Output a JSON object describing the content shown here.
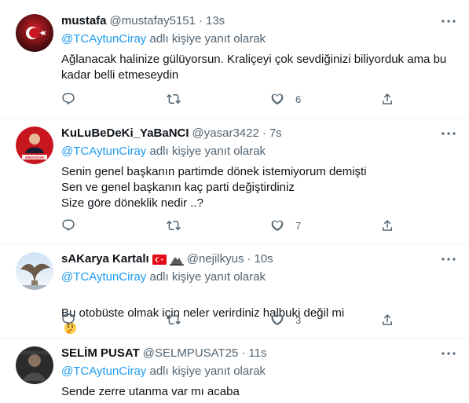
{
  "tweets": [
    {
      "name": "mustafa",
      "handle": "@mustafay5151",
      "time": "13s",
      "reply_prefix": "@TCAytunCiray",
      "reply_suffix": " adlı kişiye yanıt olarak",
      "text": "Ağlanacak halinize gülüyorsun. Kraliçeyi çok sevdiğinizi biliyorduk ama bu\nkadar belli etmeseydin",
      "reply_count": "",
      "retweet_count": "",
      "like_count": "6",
      "avatar": "turkish-flag-avatar"
    },
    {
      "name": "KuLuBeDeKi_YaBaNCI",
      "handle": "@yasar3422",
      "time": "7s",
      "reply_prefix": "@TCAytunCiray",
      "reply_suffix": " adlı kişiye yanıt olarak",
      "text": "Senin genel başkanın partimde dönek istemiyorum demişti\nSen ve genel başkanın kaç parti değiştirdiniz\nSize göre döneklik nedir ..?",
      "reply_count": "",
      "retweet_count": "",
      "like_count": "7",
      "avatar": "red-portrait-avatar",
      "avatar_caption": "ERDOĞAN"
    },
    {
      "name": "sAKarya Kartalı",
      "handle": "@nejilkyus",
      "time": "10s",
      "reply_prefix": "@TCAytunCiray",
      "reply_suffix": " adlı kişiye yanıt olarak",
      "text": "Bu otobüste olmak için neler verirdiniz halbuki değil mi",
      "reply_count": "",
      "retweet_count": "",
      "like_count": "3",
      "avatar": "eagle-statue-avatar"
    },
    {
      "name": "SELİM PUSAT",
      "handle": "@SELMPUSAT25",
      "time": "11s",
      "reply_prefix": "@TCAytunCiray",
      "reply_suffix": " adlı kişiye yanıt olarak",
      "text": "Sende zerre utanma var mı acaba",
      "avatar": "dark-portrait-avatar"
    }
  ],
  "icons": {
    "reply": "reply-icon",
    "retweet": "retweet-icon",
    "like": "heart-icon",
    "share": "share-icon",
    "more": "more-options-icon",
    "thinking": "thinking-face-emoji"
  },
  "colors": {
    "accent": "#1d9bf0",
    "secondary_text": "#536471",
    "border": "#eff3f4"
  }
}
